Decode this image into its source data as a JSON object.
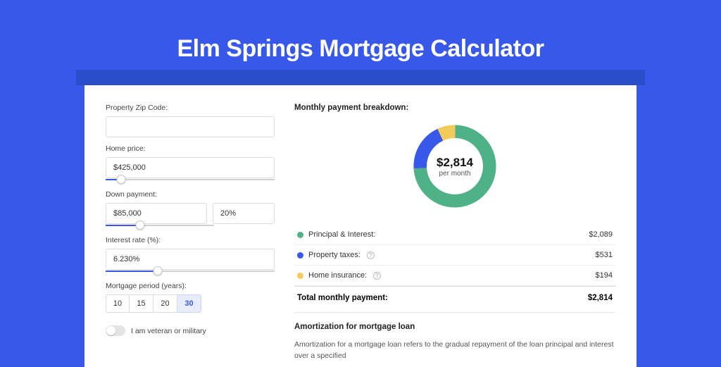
{
  "title": "Elm Springs Mortgage Calculator",
  "form": {
    "zip_label": "Property Zip Code:",
    "zip_value": "",
    "home_price_label": "Home price:",
    "home_price_value": "$425,000",
    "down_payment_label": "Down payment:",
    "down_payment_value": "$85,000",
    "down_payment_pct": "20%",
    "interest_label": "Interest rate (%):",
    "interest_value": "6.230%",
    "period_label": "Mortgage period (years):",
    "period_options": [
      "10",
      "15",
      "20",
      "30"
    ],
    "period_selected": "30",
    "veteran_label": "I am veteran or military"
  },
  "breakdown": {
    "title": "Monthly payment breakdown:",
    "amount": "$2,814",
    "period": "per month",
    "items": [
      {
        "label": "Principal & Interest:",
        "value": "$2,089",
        "color": "#4fb286",
        "info": false
      },
      {
        "label": "Property taxes:",
        "value": "$531",
        "color": "#3858e9",
        "info": true
      },
      {
        "label": "Home insurance:",
        "value": "$194",
        "color": "#f2cc5a",
        "info": true
      }
    ],
    "total_label": "Total monthly payment:",
    "total_value": "$2,814"
  },
  "amort": {
    "title": "Amortization for mortgage loan",
    "text": "Amortization for a mortgage loan refers to the gradual repayment of the loan principal and interest over a specified"
  },
  "chart_data": {
    "type": "pie",
    "title": "Monthly payment breakdown",
    "center_label": "$2,814 per month",
    "series": [
      {
        "name": "Principal & Interest",
        "value": 2089,
        "color": "#4fb286"
      },
      {
        "name": "Property taxes",
        "value": 531,
        "color": "#3858e9"
      },
      {
        "name": "Home insurance",
        "value": 194,
        "color": "#f2cc5a"
      }
    ],
    "total": 2814
  }
}
